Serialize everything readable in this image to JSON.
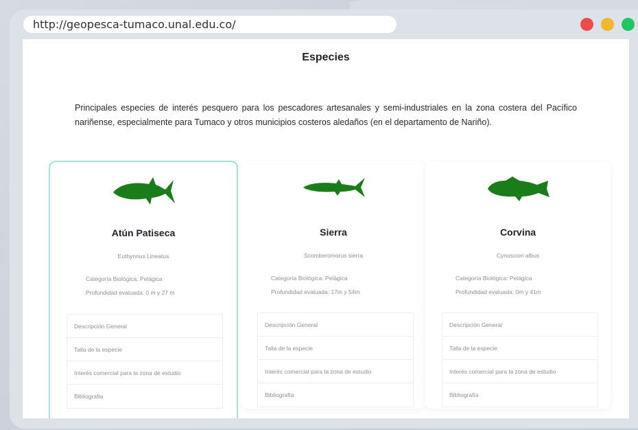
{
  "browser": {
    "url": "http://geopesca-tumaco.unal.edu.co/",
    "colors": {
      "red": "#ee4b4b",
      "yellow": "#f5b62c",
      "green": "#22c55e"
    }
  },
  "page": {
    "title": "Especies",
    "intro": "Principales especies de interés pesquero para los pescadores artesanales y semi-industriales en la zona costera del Pacífico nariñense, especialmente para Tumaco y otros municipios costeros aledaños (en el departamento de Nariño)."
  },
  "species": [
    {
      "name": "Atún Patiseca",
      "scientific": "Euthynnus Lineatus",
      "category": "Categoría Biológica: Pelágica",
      "depth": "Profundidad evaluada: 0 m y 27 m",
      "menu": [
        "Descripción General",
        "Talla de la especie",
        "Interés comercial para la zona de estudio",
        "Bibliografía"
      ]
    },
    {
      "name": "Sierra",
      "scientific": "Scomberomorus sierra",
      "category": "Categoría Biológica: Pelágica",
      "depth": "Profundidad evaluada: 17m y 54m",
      "menu": [
        "Descripción General",
        "Talla de la especie",
        "Interés comercial para la zona de estudio",
        "Bibliografía"
      ]
    },
    {
      "name": "Corvina",
      "scientific": "Cynoscion albus",
      "category": "Categoría Biológica: Pelágica",
      "depth": "Profundidad evaluada: 0m y 41m",
      "menu": [
        "Descripción General",
        "Talla de la especie",
        "Interés comercial para la zona de estudio",
        "Bibliografía"
      ]
    }
  ],
  "fish_color": "#1a7d1a",
  "accent_border": "#a6e1da"
}
